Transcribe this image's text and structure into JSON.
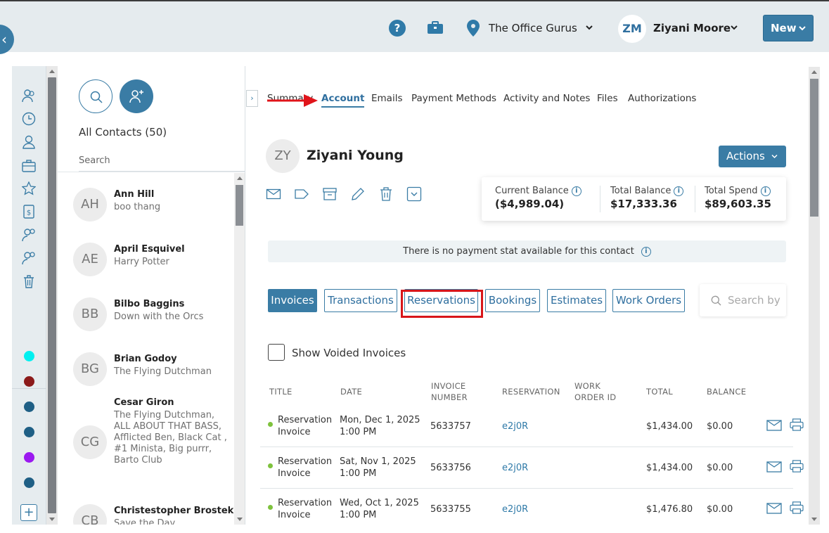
{
  "topbar": {
    "location": "The Office Gurus",
    "user_initials": "ZM",
    "user_name": "Ziyani Moore",
    "new_label": "New"
  },
  "contacts": {
    "title": "All Contacts (50)",
    "search_placeholder": "Search",
    "items": [
      {
        "initials": "AH",
        "name": "Ann Hill",
        "sub": "boo thang"
      },
      {
        "initials": "AE",
        "name": "April Esquivel",
        "sub": "Harry Potter"
      },
      {
        "initials": "BB",
        "name": "Bilbo Baggins",
        "sub": "Down with the Orcs"
      },
      {
        "initials": "BG",
        "name": "Brian Godoy",
        "sub": "The Flying Dutchman"
      },
      {
        "initials": "CG",
        "name": "Cesar Giron",
        "sub": "The Flying Dutchman, ALL ABOUT THAT BASS, Afflicted Ben, Black Cat , #1 Minista, Big purrr, Barto Club"
      },
      {
        "initials": "CB",
        "name": "Christestopher Brostek",
        "sub": "Save the Day"
      }
    ],
    "rail_colors": [
      "#00f0f0",
      "#8b1a1a",
      "#1f5f85",
      "#1f5f85",
      "#9b19f0",
      "#1f5f85"
    ]
  },
  "tabs": [
    "Summary",
    "Account",
    "Emails",
    "Payment Methods",
    "Activity and Notes",
    "Files",
    "Authorizations"
  ],
  "profile": {
    "initials": "ZY",
    "name": "Ziyani Young",
    "actions_label": "Actions"
  },
  "balances": {
    "current_label": "Current Balance",
    "current_value": "($4,989.04)",
    "total_label": "Total Balance",
    "total_value": "$17,333.36",
    "spend_label": "Total Spend",
    "spend_value": "$89,603.35"
  },
  "notice": "There is no payment stat available for this contact",
  "subtabs": [
    "Invoices",
    "Transactions",
    "Reservations",
    "Bookings",
    "Estimates",
    "Work Orders"
  ],
  "search_placeholder": "Search by",
  "show_voided": "Show Voided Invoices",
  "table": {
    "headers": [
      "TITLE",
      "DATE",
      "INVOICE NUMBER",
      "RESERVATION",
      "WORK ORDER ID",
      "TOTAL",
      "BALANCE"
    ],
    "rows": [
      {
        "title": "Reservation Invoice",
        "date": "Mon, Dec 1, 2025 1:00 PM",
        "number": "5633757",
        "reservation": "e2j0R",
        "work_order": "",
        "total": "$1,434.00",
        "balance": "$0.00"
      },
      {
        "title": "Reservation Invoice",
        "date": "Sat, Nov 1, 2025 1:00 PM",
        "number": "5633756",
        "reservation": "e2j0R",
        "work_order": "",
        "total": "$1,434.00",
        "balance": "$0.00"
      },
      {
        "title": "Reservation Invoice",
        "date": "Wed, Oct 1, 2025 1:00 PM",
        "number": "5633755",
        "reservation": "e2j0R",
        "work_order": "",
        "total": "$1,476.80",
        "balance": "$0.00"
      }
    ]
  }
}
